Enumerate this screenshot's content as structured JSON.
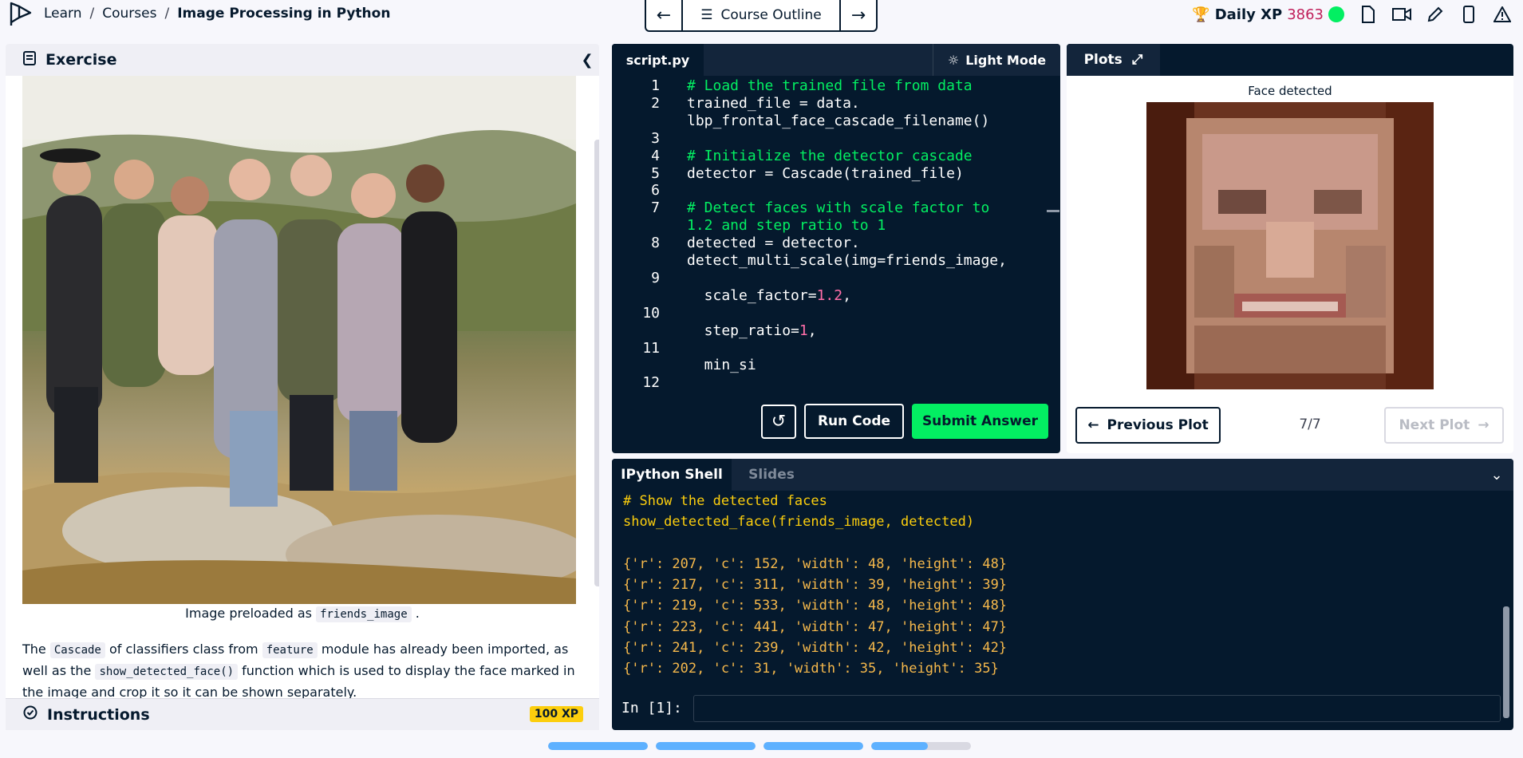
{
  "breadcrumb": {
    "learn": "Learn",
    "courses": "Courses",
    "current": "Image Processing in Python",
    "sep": "/"
  },
  "course_nav": {
    "outline_label": "Course Outline"
  },
  "header": {
    "xp_label": "Daily XP",
    "xp_value": "3863",
    "status_color": "#03ef62",
    "accent_color": "#c01f5a"
  },
  "icons": {
    "logo": "datacamp-logo-icon",
    "trophy": "trophy-icon",
    "doc": "document-icon",
    "video": "video-icon",
    "pencil": "pencil-icon",
    "mobile": "mobile-icon",
    "alert": "alert-icon"
  },
  "exercise": {
    "header": "Exercise",
    "image_caption_prefix": "Image preloaded as",
    "image_caption_code": "friends_image",
    "image_caption_suffix": ".",
    "desc_1": "The",
    "desc_code_1": "Cascade",
    "desc_2": "of classifiers class from",
    "desc_code_2": "feature",
    "desc_3": "module has already been imported, as well as the",
    "desc_code_3": "show_detected_face()",
    "desc_4": "function which is used to display the face marked in the image and crop it so it can be shown separately."
  },
  "instructions": {
    "label": "Instructions",
    "xp_badge": "100 XP"
  },
  "editor": {
    "tab": "script.py",
    "light_mode": "Light Mode",
    "lines": [
      {
        "n": "1",
        "text": "# Load the trained file from data",
        "kind": "comment"
      },
      {
        "n": "2",
        "text": "trained_file = data.",
        "kind": "code"
      },
      {
        "n": "",
        "text": "lbp_frontal_face_cascade_filename()",
        "kind": "code"
      },
      {
        "n": "3",
        "text": "",
        "kind": "code"
      },
      {
        "n": "4",
        "text": "# Initialize the detector cascade",
        "kind": "comment"
      },
      {
        "n": "5",
        "text": "detector = Cascade(trained_file)",
        "kind": "code"
      },
      {
        "n": "6",
        "text": "",
        "kind": "code"
      },
      {
        "n": "7",
        "text": "# Detect faces with scale factor to",
        "kind": "comment"
      },
      {
        "n": "",
        "text": "1.2 and step ratio to 1",
        "kind": "comment"
      },
      {
        "n": "8",
        "text": "detected = detector.",
        "kind": "code"
      },
      {
        "n": "",
        "text": "detect_multi_scale(img=friends_image,",
        "kind": "code"
      },
      {
        "n": "9",
        "text": "",
        "kind": "code"
      },
      {
        "n": "",
        "text": "  scale_factor=",
        "num": "1.2",
        "tail": ",",
        "kind": "code"
      },
      {
        "n": "10",
        "text": "",
        "kind": "code"
      },
      {
        "n": "",
        "text": "  step_ratio=",
        "num": "1",
        "tail": ",",
        "kind": "code"
      },
      {
        "n": "11",
        "text": "",
        "kind": "code"
      },
      {
        "n": "",
        "text": "  min_si",
        "kind": "code"
      },
      {
        "n": "12",
        "text": "",
        "kind": "code"
      }
    ],
    "run_label": "Run Code",
    "submit_label": "Submit Answer"
  },
  "plots": {
    "tab": "Plots",
    "title": "Face detected",
    "prev_label": "Previous Plot",
    "next_label": "Next Plot",
    "pager": "7/7"
  },
  "console": {
    "tab_active": "IPython Shell",
    "tab_inactive": "Slides",
    "lines": [
      {
        "text": "# Show the detected faces",
        "kind": "cmd"
      },
      {
        "text": "show_detected_face(friends_image, detected)",
        "kind": "cmd"
      },
      {
        "text": "",
        "kind": "out"
      },
      {
        "text": "{'r': 207, 'c': 152, 'width': 48, 'height': 48}",
        "kind": "out"
      },
      {
        "text": "{'r': 217, 'c': 311, 'width': 39, 'height': 39}",
        "kind": "out"
      },
      {
        "text": "{'r': 219, 'c': 533, 'width': 48, 'height': 48}",
        "kind": "out"
      },
      {
        "text": "{'r': 223, 'c': 441, 'width': 47, 'height': 47}",
        "kind": "out"
      },
      {
        "text": "{'r': 241, 'c': 239, 'width': 42, 'height': 42}",
        "kind": "out"
      },
      {
        "text": "{'r': 202, 'c': 31, 'width': 35, 'height': 35}",
        "kind": "out"
      }
    ],
    "prompt": "In [1]:"
  },
  "progress": {
    "segments": [
      1,
      1,
      1,
      0.57
    ],
    "color": "#5eb1ff"
  }
}
